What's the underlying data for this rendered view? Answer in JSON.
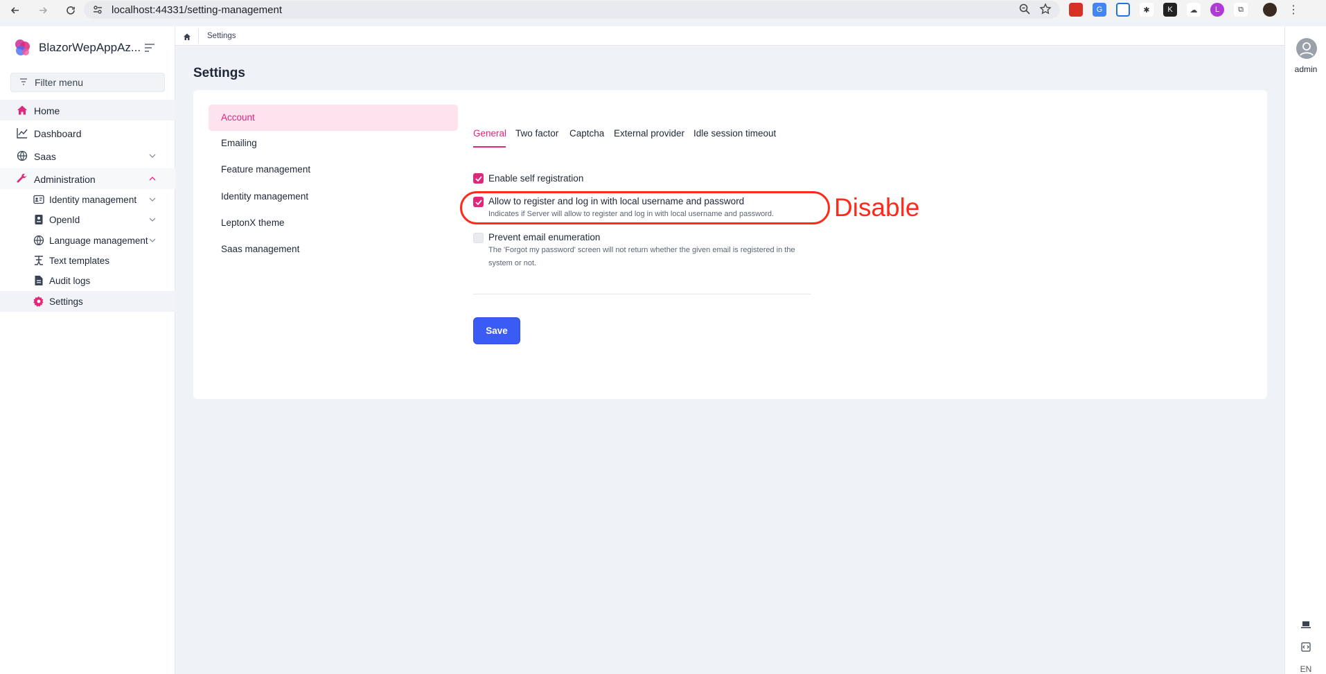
{
  "browser": {
    "url": "localhost:44331/setting-management"
  },
  "app": {
    "name": "BlazorWepAppAz..."
  },
  "sidebar": {
    "filter_placeholder": "Filter menu",
    "items": [
      {
        "label": "Home",
        "icon": "home-icon"
      },
      {
        "label": "Dashboard",
        "icon": "chart-icon"
      },
      {
        "label": "Saas",
        "icon": "globe-icon"
      },
      {
        "label": "Administration",
        "icon": "wrench-icon"
      },
      {
        "label": "Identity management",
        "icon": "id-card-icon"
      },
      {
        "label": "OpenId",
        "icon": "openid-icon"
      },
      {
        "label": "Language management",
        "icon": "globe-icon"
      },
      {
        "label": "Text templates",
        "icon": "text-template-icon"
      },
      {
        "label": "Audit logs",
        "icon": "file-icon"
      },
      {
        "label": "Settings",
        "icon": "gear-icon"
      }
    ]
  },
  "breadcrumb": {
    "current": "Settings"
  },
  "page": {
    "title": "Settings"
  },
  "settings_nav": [
    {
      "label": "Account",
      "active": true
    },
    {
      "label": "Emailing"
    },
    {
      "label": "Feature management"
    },
    {
      "label": "Identity management"
    },
    {
      "label": "LeptonX theme"
    },
    {
      "label": "Saas management"
    }
  ],
  "tabs": [
    {
      "label": "General",
      "active": true
    },
    {
      "label": "Two factor"
    },
    {
      "label": "Captcha"
    },
    {
      "label": "External provider"
    },
    {
      "label": "Idle session timeout"
    }
  ],
  "options": {
    "self_registration": {
      "label": "Enable self registration",
      "checked": true
    },
    "local_login": {
      "label": "Allow to register and log in with local username and password",
      "help": "Indicates if Server will allow to register and log in with local username and password.",
      "checked": true
    },
    "email_enum": {
      "label": "Prevent email enumeration",
      "help": "The 'Forgot my password' screen will not return whether the given email is registered in the system or not.",
      "checked": false
    }
  },
  "save_label": "Save",
  "user": {
    "name": "admin"
  },
  "rail": {
    "language": "EN"
  },
  "annotation": {
    "text": "Disable"
  },
  "colors": {
    "accent": "#e2267a",
    "primary_button": "#3b5bf5",
    "annotation": "#ff2a1a"
  }
}
